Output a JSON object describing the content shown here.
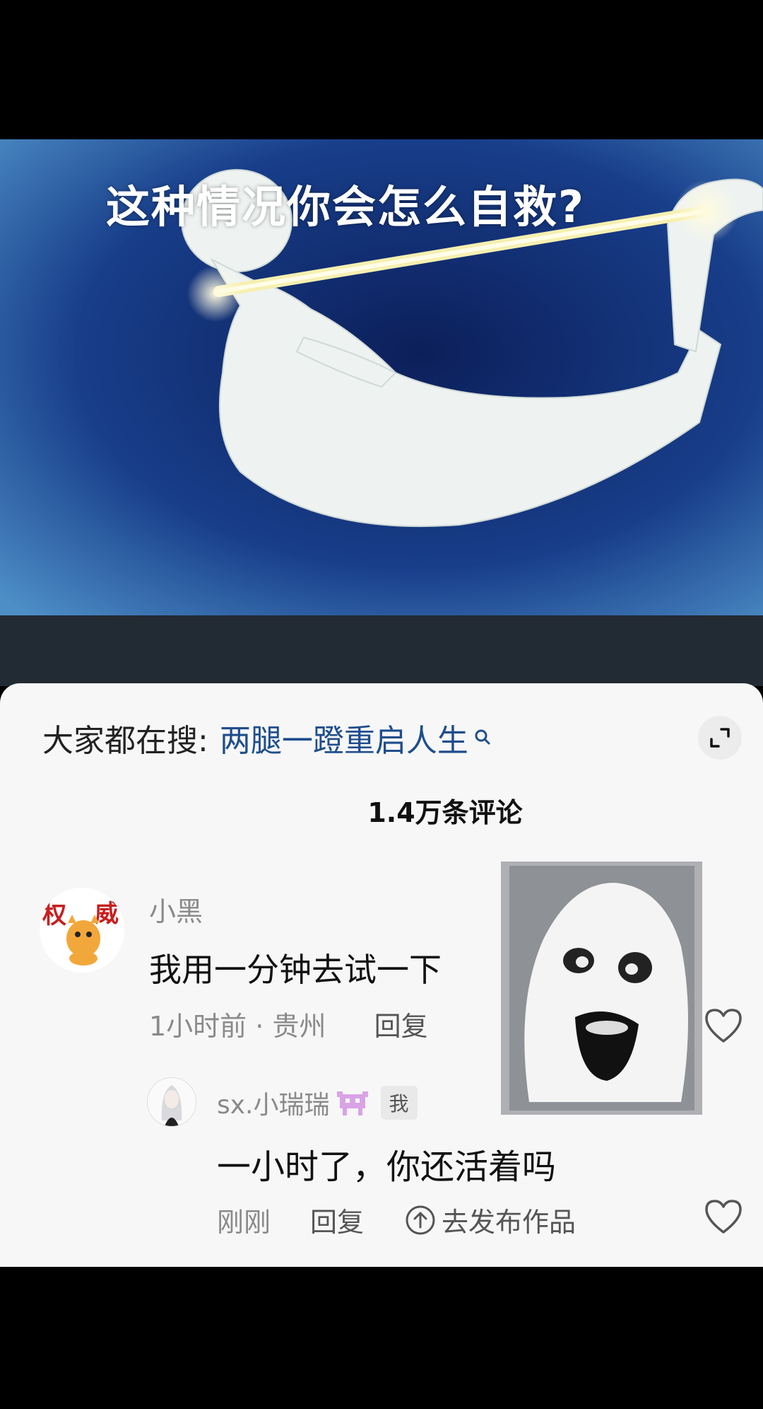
{
  "video": {
    "title": "这种情况你会怎么自救?"
  },
  "search": {
    "prefix": "大家都在搜:",
    "term": "两腿一蹬重启人生"
  },
  "comments_header": {
    "count_label": "1.4万条评论"
  },
  "comment": {
    "username": "小黑",
    "text": "我用一分钟去试一下",
    "time": "1小时前",
    "location": "贵州",
    "reply_label": "回复"
  },
  "reply": {
    "username": "sx.小瑞瑞",
    "me_tag": "我",
    "text": "一小时了，你还活着吗",
    "time": "刚刚",
    "reply_label": "回复",
    "publish_label": "去发布作品"
  },
  "colors": {
    "search_term": "#1f4e8c",
    "sheet_bg": "#f7f7f7"
  }
}
